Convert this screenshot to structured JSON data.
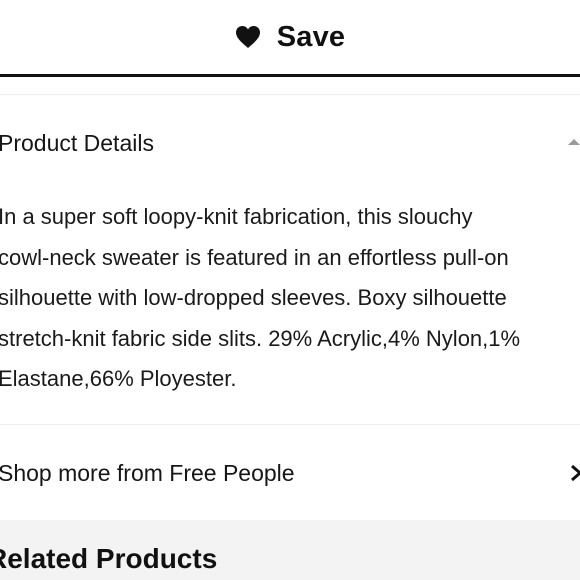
{
  "save_bar": {
    "label": "Save",
    "icon": "heart-icon"
  },
  "product_details": {
    "title": "Product Details",
    "expanded": true,
    "description_lines": [
      "In a super soft loopy-knit fabrication, this slouchy",
      "cowl-neck sweater is featured in an effortless pull-on",
      "silhouette with low-dropped sleeves. Boxy silhouette",
      "stretch-knit fabric side slits. 29% Acrylic,4% Nylon,1%",
      "Elastane,66% Ployester."
    ]
  },
  "shop_more": {
    "label": "Shop more from Free People",
    "icon": "chevron-right-icon"
  },
  "related_products": {
    "title": "Related Products"
  },
  "colors": {
    "text": "#111111",
    "divider": "#ececec",
    "related_background": "#f3f3f3"
  }
}
